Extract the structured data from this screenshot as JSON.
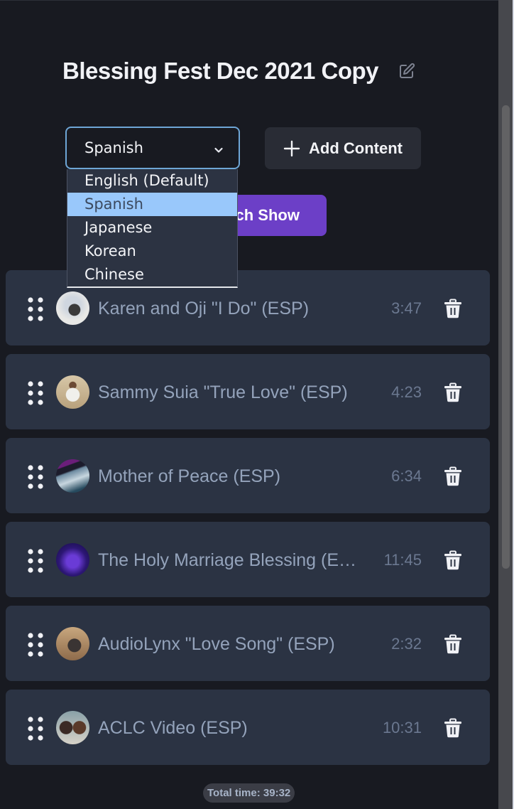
{
  "playlist": {
    "title": "Blessing Fest Dec 2021 Copy",
    "edit_icon": "edit-icon"
  },
  "language_select": {
    "selected": "Spanish",
    "options": [
      {
        "label": "English (Default)",
        "highlighted": false
      },
      {
        "label": "Spanish",
        "highlighted": true
      },
      {
        "label": "Japanese",
        "highlighted": false
      },
      {
        "label": "Korean",
        "highlighted": false
      },
      {
        "label": "Chinese",
        "highlighted": false
      }
    ]
  },
  "buttons": {
    "add_content": "Add Content",
    "watch_show": "Watch Show"
  },
  "colors": {
    "accent_purple": "#6c3fc7",
    "highlight_blue": "#99c8fb",
    "card_bg": "#2b3343",
    "page_bg": "#181a21"
  },
  "items": [
    {
      "title": "Karen and Oji \"I Do\" (ESP)",
      "duration": "3:47",
      "thumb": "guitar-player"
    },
    {
      "title": "Sammy Suia \"True Love\" (ESP)",
      "duration": "4:23",
      "thumb": "man-white-shirt"
    },
    {
      "title": "Mother of Peace (ESP)",
      "duration": "6:34",
      "thumb": "ocean-purple-sky"
    },
    {
      "title": "The Holy Marriage Blessing (ESP)",
      "duration": "11:45",
      "thumb": "galaxy-text"
    },
    {
      "title": "AudioLynx \"Love Song\" (ESP)",
      "duration": "2:32",
      "thumb": "man-jacket"
    },
    {
      "title": "ACLC Video (ESP)",
      "duration": "10:31",
      "thumb": "couple"
    }
  ],
  "total": {
    "label": "Total time: 39:32"
  }
}
